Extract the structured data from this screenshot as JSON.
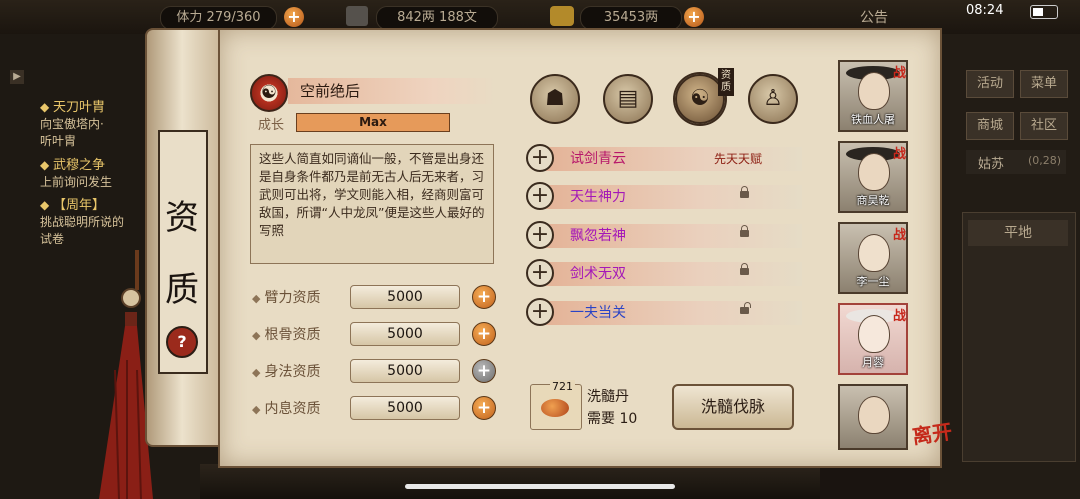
{
  "status_bar": {
    "time": "08:24"
  },
  "top_resources": {
    "stamina": "体力 279/360",
    "silver": "842两 188文",
    "gold": "35453两",
    "notice": "公告"
  },
  "left_quests": [
    {
      "title": "天刀叶胄",
      "desc1": "向宝傲塔内·",
      "desc2": "听叶胄"
    },
    {
      "title": "武穆之争",
      "desc1": "上前询问发生",
      "desc2": ""
    },
    {
      "title": "【周年】",
      "desc1": "挑战聪明所说的",
      "desc2": "试卷"
    }
  ],
  "right_menu": [
    "活动",
    "菜单",
    "商城",
    "社区"
  ],
  "right_location": {
    "name": "姑苏",
    "coords": "(0,28)",
    "terrain": "平地"
  },
  "scroll_title": [
    "资",
    "质"
  ],
  "trait": {
    "name": "空前绝后",
    "growth_label": "成长",
    "growth_value": "Max"
  },
  "description": "这些人简直如同谪仙一般，不管是出身还是自身条件都乃是前无古人后无来者，习武则可出将，学文则能入相，经商则富可敌国，所谓“人中龙凤”便是这些人最好的写照",
  "stats": [
    {
      "label": "臂力资质",
      "value": "5000",
      "button": "+"
    },
    {
      "label": "根骨资质",
      "value": "5000",
      "button": "+"
    },
    {
      "label": "身法资质",
      "value": "5000",
      "button": "+"
    },
    {
      "label": "内息资质",
      "value": "5000",
      "button": "+"
    }
  ],
  "tabs": [
    {
      "icon": "hat-person-icon"
    },
    {
      "icon": "book-icon"
    },
    {
      "icon": "yinyang-icon",
      "tag": "资质"
    },
    {
      "icon": "body-icon"
    }
  ],
  "talents": [
    {
      "name": "试剑青云",
      "tag": "先天天赋",
      "color": "#b7176a",
      "lock": "none"
    },
    {
      "name": "天生神力",
      "tag": "",
      "color": "#a417b8",
      "lock": "locked"
    },
    {
      "name": "飘忽若神",
      "tag": "",
      "color": "#a417b8",
      "lock": "locked"
    },
    {
      "name": "剑术无双",
      "tag": "",
      "color": "#a417b8",
      "lock": "locked"
    },
    {
      "name": "一夫当关",
      "tag": "",
      "color": "#2a44c6",
      "lock": "open"
    }
  ],
  "item": {
    "count": "721",
    "name": "洗髓丹",
    "need": "需要 10",
    "action": "洗髓伐脉"
  },
  "party": [
    {
      "name": "铁血人屠",
      "badge": "战"
    },
    {
      "name": "商昊乾",
      "badge": "战"
    },
    {
      "name": "李一尘",
      "badge": "战"
    },
    {
      "name": "月蓉",
      "badge": "战"
    },
    {
      "name": "",
      "badge": ""
    }
  ],
  "leave_label": "离开"
}
